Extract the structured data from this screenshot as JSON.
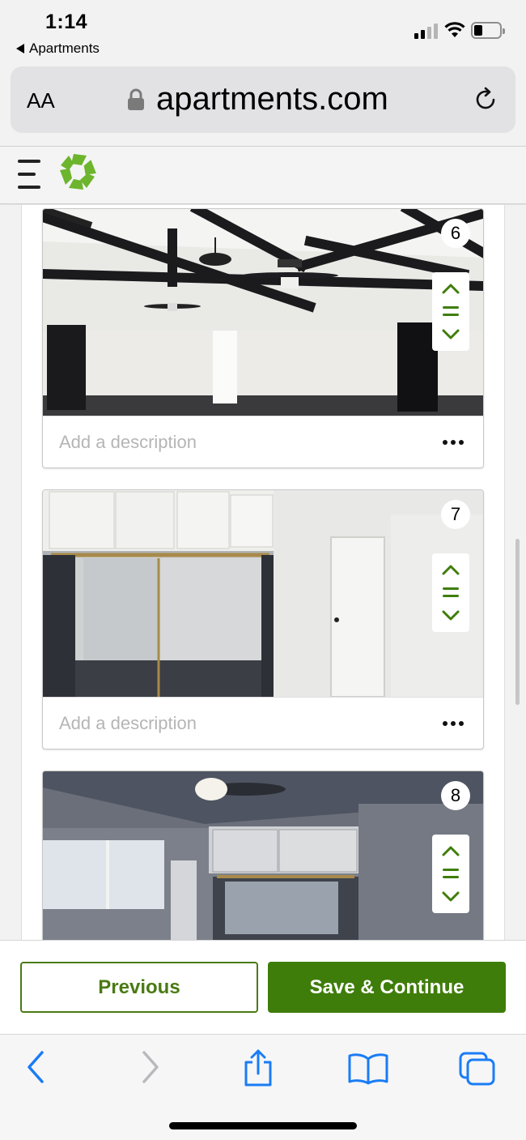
{
  "status_bar": {
    "time": "1:14",
    "back_app": "Apartments"
  },
  "url_bar": {
    "text_size_label": "AA",
    "domain": "apartments.com"
  },
  "photos": [
    {
      "number": "6",
      "description_placeholder": "Add a description"
    },
    {
      "number": "7",
      "description_placeholder": "Add a description"
    },
    {
      "number": "8"
    }
  ],
  "footer": {
    "previous_label": "Previous",
    "save_label": "Save & Continue"
  },
  "colors": {
    "accent": "#3f7d0a",
    "logo": "#6cb52d",
    "browser_blue": "#1a7cf5"
  }
}
